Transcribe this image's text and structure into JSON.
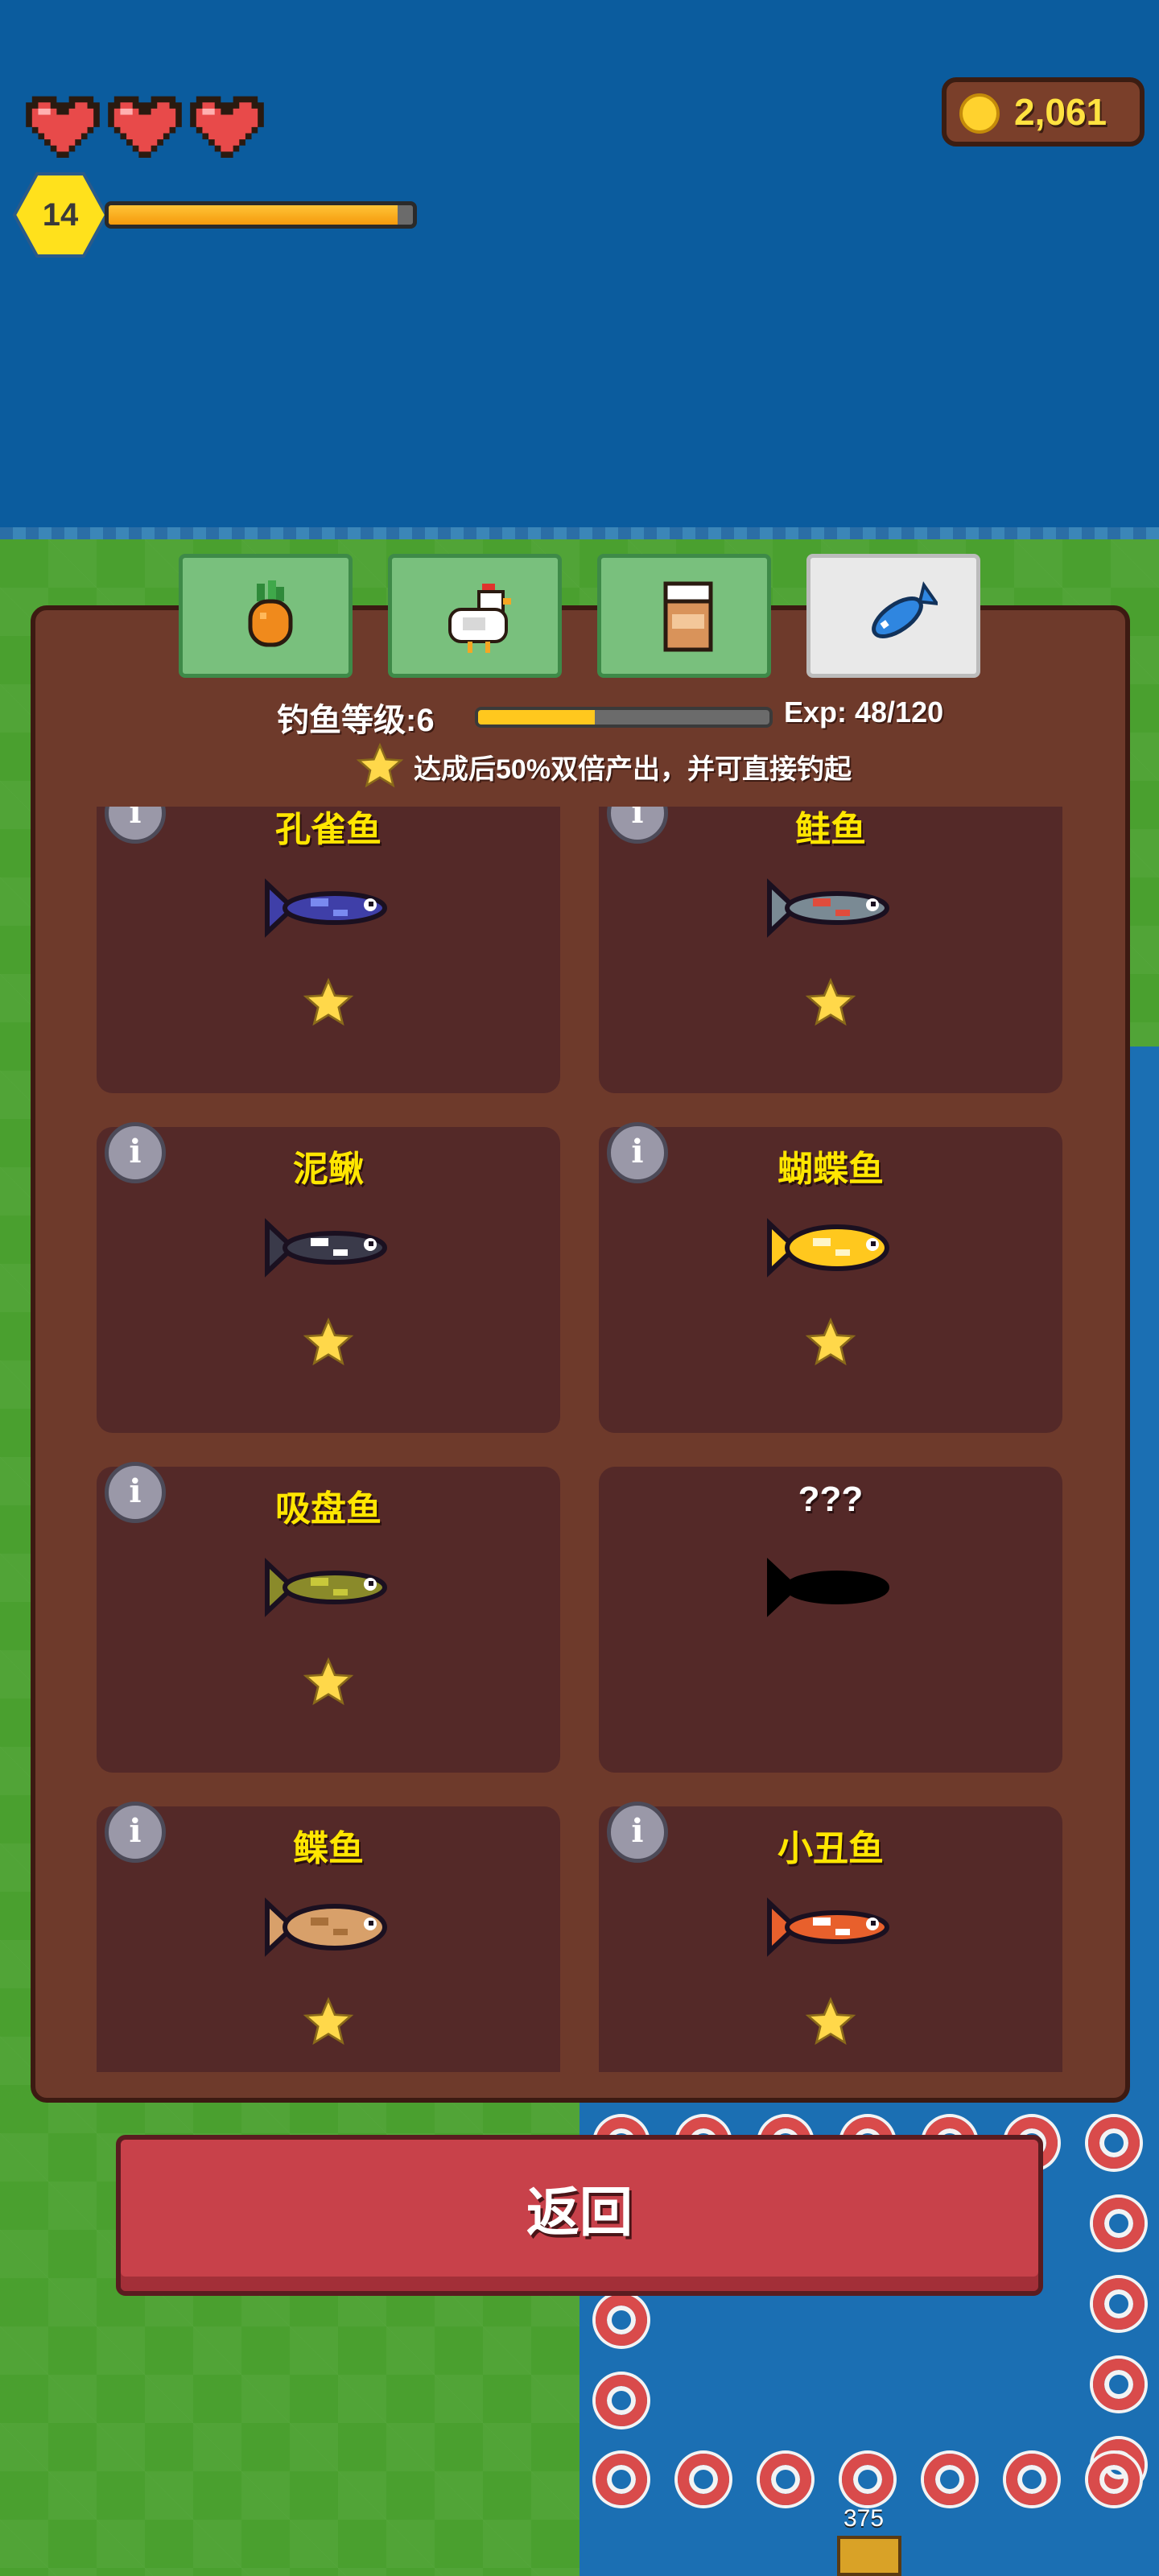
{
  "hud": {
    "hearts": 3,
    "level": "14",
    "xp_progress": 0.95,
    "coins": "2,061"
  },
  "tabs": [
    {
      "name": "crops",
      "icon": "carrot-icon",
      "active": false
    },
    {
      "name": "animals",
      "icon": "chicken-icon",
      "active": false
    },
    {
      "name": "products",
      "icon": "jar-icon",
      "active": false
    },
    {
      "name": "fish",
      "icon": "fish-icon",
      "active": true
    }
  ],
  "fishing": {
    "level_label": "钓鱼等级:6",
    "exp_label": "Exp: 48/120",
    "exp_progress": 0.4,
    "bonus_text": "达成后50%双倍产出，并可直接钓起"
  },
  "fish_cards": [
    {
      "name": "孔雀鱼",
      "icon": "guppy-fish-icon",
      "stars": 1,
      "unlocked": true
    },
    {
      "name": "鲑鱼",
      "icon": "salmon-fish-icon",
      "stars": 1,
      "unlocked": true
    },
    {
      "name": "泥鳅",
      "icon": "loach-fish-icon",
      "stars": 1,
      "unlocked": true
    },
    {
      "name": "蝴蝶鱼",
      "icon": "butterfly-fish-icon",
      "stars": 1,
      "unlocked": true
    },
    {
      "name": "吸盘鱼",
      "icon": "suckerfish-icon",
      "stars": 1,
      "unlocked": true
    },
    {
      "name": "???",
      "icon": "unknown-fish-silhouette",
      "stars": 0,
      "unlocked": false
    },
    {
      "name": "鲽鱼",
      "icon": "flounder-fish-icon",
      "stars": 1,
      "unlocked": true
    },
    {
      "name": "小丑鱼",
      "icon": "clownfish-icon",
      "stars": 1,
      "unlocked": true
    }
  ],
  "back_button": "返回",
  "pond_number": "375",
  "colors": {
    "water": "#0b5c9e",
    "grass": "#4aa02f",
    "panel": "#6e3a2b",
    "card": "#542928",
    "fish_name": "#ffe600",
    "back_button": "#c8414a"
  }
}
